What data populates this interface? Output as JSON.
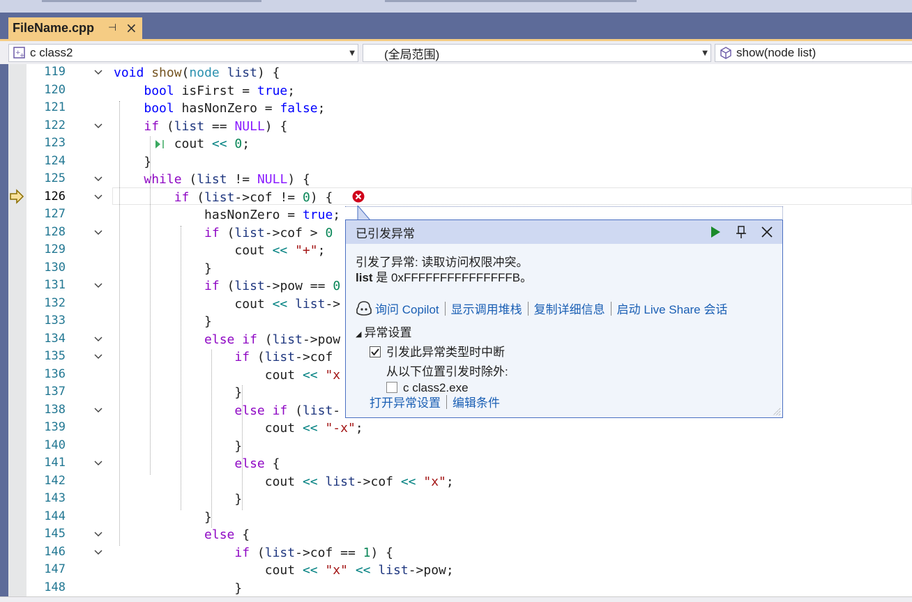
{
  "tab": {
    "filename": "FileName.cpp",
    "pin_icon": "pin-icon",
    "close_icon": "close-icon"
  },
  "nav": {
    "class_combo": "c class2",
    "scope_combo": "(全局范围)",
    "member_combo": "show(node list)"
  },
  "current_line": 126,
  "lines": [
    {
      "n": "119",
      "fold": "v"
    },
    {
      "n": "120",
      "fold": ""
    },
    {
      "n": "121",
      "fold": ""
    },
    {
      "n": "122",
      "fold": "v"
    },
    {
      "n": "123",
      "fold": ""
    },
    {
      "n": "124",
      "fold": ""
    },
    {
      "n": "125",
      "fold": "v"
    },
    {
      "n": "126",
      "fold": "v"
    },
    {
      "n": "127",
      "fold": ""
    },
    {
      "n": "128",
      "fold": "v"
    },
    {
      "n": "129",
      "fold": ""
    },
    {
      "n": "130",
      "fold": ""
    },
    {
      "n": "131",
      "fold": "v"
    },
    {
      "n": "132",
      "fold": ""
    },
    {
      "n": "133",
      "fold": ""
    },
    {
      "n": "134",
      "fold": "v"
    },
    {
      "n": "135",
      "fold": "v"
    },
    {
      "n": "136",
      "fold": ""
    },
    {
      "n": "137",
      "fold": ""
    },
    {
      "n": "138",
      "fold": "v"
    },
    {
      "n": "139",
      "fold": ""
    },
    {
      "n": "140",
      "fold": ""
    },
    {
      "n": "141",
      "fold": "v"
    },
    {
      "n": "142",
      "fold": ""
    },
    {
      "n": "143",
      "fold": ""
    },
    {
      "n": "144",
      "fold": ""
    },
    {
      "n": "145",
      "fold": "v"
    },
    {
      "n": "146",
      "fold": "v"
    },
    {
      "n": "147",
      "fold": ""
    },
    {
      "n": "148",
      "fold": ""
    }
  ],
  "code": [
    [
      [
        "kw",
        "void "
      ],
      [
        "fn",
        "show"
      ],
      [
        "",
        "("
      ],
      [
        "ty",
        "node "
      ],
      [
        "vr",
        "list"
      ],
      [
        "",
        ") {"
      ]
    ],
    [
      [
        "",
        "    "
      ],
      [
        "kw",
        "bool "
      ],
      [
        "",
        "isFirst = "
      ],
      [
        "kw",
        "true"
      ],
      [
        "",
        ";"
      ]
    ],
    [
      [
        "",
        "    "
      ],
      [
        "kw",
        "bool "
      ],
      [
        "",
        "hasNonZero = "
      ],
      [
        "kw",
        "false"
      ],
      [
        "",
        ";"
      ]
    ],
    [
      [
        "",
        "    "
      ],
      [
        "kc",
        "if "
      ],
      [
        "",
        "("
      ],
      [
        "vr",
        "list"
      ],
      [
        "",
        " == "
      ],
      [
        "mc",
        "NULL"
      ],
      [
        "",
        ") {"
      ]
    ],
    [
      [
        "",
        "        cout "
      ],
      [
        "op",
        "<< "
      ],
      [
        "nm",
        "0"
      ],
      [
        "",
        ";"
      ]
    ],
    [
      [
        "",
        "    }"
      ]
    ],
    [
      [
        "",
        "    "
      ],
      [
        "kc",
        "while "
      ],
      [
        "",
        "("
      ],
      [
        "vr",
        "list"
      ],
      [
        "",
        " != "
      ],
      [
        "mc",
        "NULL"
      ],
      [
        "",
        ") {"
      ]
    ],
    [
      [
        "",
        "        "
      ],
      [
        "kc",
        "if "
      ],
      [
        "",
        "("
      ],
      [
        "vr",
        "list"
      ],
      [
        "",
        "->cof != "
      ],
      [
        "nm",
        "0"
      ],
      [
        "",
        ") {"
      ]
    ],
    [
      [
        "",
        "            hasNonZero = "
      ],
      [
        "kw",
        "true"
      ],
      [
        "",
        ";"
      ]
    ],
    [
      [
        "",
        "            "
      ],
      [
        "kc",
        "if "
      ],
      [
        "",
        "("
      ],
      [
        "vr",
        "list"
      ],
      [
        "",
        "->cof > "
      ],
      [
        "nm",
        "0"
      ]
    ],
    [
      [
        "",
        "                cout "
      ],
      [
        "op",
        "<< "
      ],
      [
        "st",
        "\"+\""
      ],
      [
        "",
        ";"
      ]
    ],
    [
      [
        "",
        "            }"
      ]
    ],
    [
      [
        "",
        "            "
      ],
      [
        "kc",
        "if "
      ],
      [
        "",
        "("
      ],
      [
        "vr",
        "list"
      ],
      [
        "",
        "->pow == "
      ],
      [
        "nm",
        "0"
      ]
    ],
    [
      [
        "",
        "                cout "
      ],
      [
        "op",
        "<< "
      ],
      [
        "vr",
        "list"
      ],
      [
        "",
        "->"
      ]
    ],
    [
      [
        "",
        "            }"
      ]
    ],
    [
      [
        "",
        "            "
      ],
      [
        "kc",
        "else if "
      ],
      [
        "",
        "("
      ],
      [
        "vr",
        "list"
      ],
      [
        "",
        "->pow"
      ]
    ],
    [
      [
        "",
        "                "
      ],
      [
        "kc",
        "if "
      ],
      [
        "",
        "("
      ],
      [
        "vr",
        "list"
      ],
      [
        "",
        "->cof"
      ]
    ],
    [
      [
        "",
        "                    cout "
      ],
      [
        "op",
        "<< "
      ],
      [
        "st",
        "\"x"
      ]
    ],
    [
      [
        "",
        "                }"
      ]
    ],
    [
      [
        "",
        "                "
      ],
      [
        "kc",
        "else if "
      ],
      [
        "",
        "("
      ],
      [
        "vr",
        "list"
      ],
      [
        "",
        "-"
      ]
    ],
    [
      [
        "",
        "                    cout "
      ],
      [
        "op",
        "<< "
      ],
      [
        "st",
        "\"-x\""
      ],
      [
        "",
        ";"
      ]
    ],
    [
      [
        "",
        "                }"
      ]
    ],
    [
      [
        "",
        "                "
      ],
      [
        "kc",
        "else "
      ],
      [
        "",
        "{"
      ]
    ],
    [
      [
        "",
        "                    cout "
      ],
      [
        "op",
        "<< "
      ],
      [
        "vr",
        "list"
      ],
      [
        "",
        "->cof "
      ],
      [
        "op",
        "<< "
      ],
      [
        "st",
        "\"x\""
      ],
      [
        "",
        ";"
      ]
    ],
    [
      [
        "",
        "                }"
      ]
    ],
    [
      [
        "",
        "            }"
      ]
    ],
    [
      [
        "",
        "            "
      ],
      [
        "kc",
        "else "
      ],
      [
        "",
        "{"
      ]
    ],
    [
      [
        "",
        "                "
      ],
      [
        "kc",
        "if "
      ],
      [
        "",
        "("
      ],
      [
        "vr",
        "list"
      ],
      [
        "",
        "->cof == "
      ],
      [
        "nm",
        "1"
      ],
      [
        "",
        ") {"
      ]
    ],
    [
      [
        "",
        "                    cout "
      ],
      [
        "op",
        "<< "
      ],
      [
        "st",
        "\"x\""
      ],
      [
        "",
        " "
      ],
      [
        "op",
        "<< "
      ],
      [
        "vr",
        "list"
      ],
      [
        "",
        "->pow;"
      ]
    ],
    [
      [
        "",
        "                }"
      ]
    ]
  ],
  "exception_popup": {
    "title": "已引发异常",
    "continue_icon": "play-icon",
    "pin_icon": "pin-icon",
    "close_icon": "close-icon",
    "message_line1": "引发了异常: 读取访问权限冲突。",
    "message_var": "list",
    "message_line2_rest": " 是 0xFFFFFFFFFFFFFFFB。",
    "links": [
      "询问 Copilot",
      "显示调用堆栈",
      "复制详细信息",
      "启动 Live Share 会话"
    ],
    "settings_header": "异常设置",
    "break_checkbox_label": "引发此异常类型时中断",
    "break_checked": true,
    "except_label": "从以下位置引发时除外:",
    "module_checkbox_label": "c class2.exe",
    "module_checked": false,
    "bottom_links": [
      "打开异常设置",
      "编辑条件"
    ]
  },
  "colors": {
    "tab_active": "#f5cc84",
    "tabbar": "#5d6b99",
    "popup_header": "#cfd9f2",
    "link": "#1a5fb4",
    "error_red": "#d0021b"
  }
}
